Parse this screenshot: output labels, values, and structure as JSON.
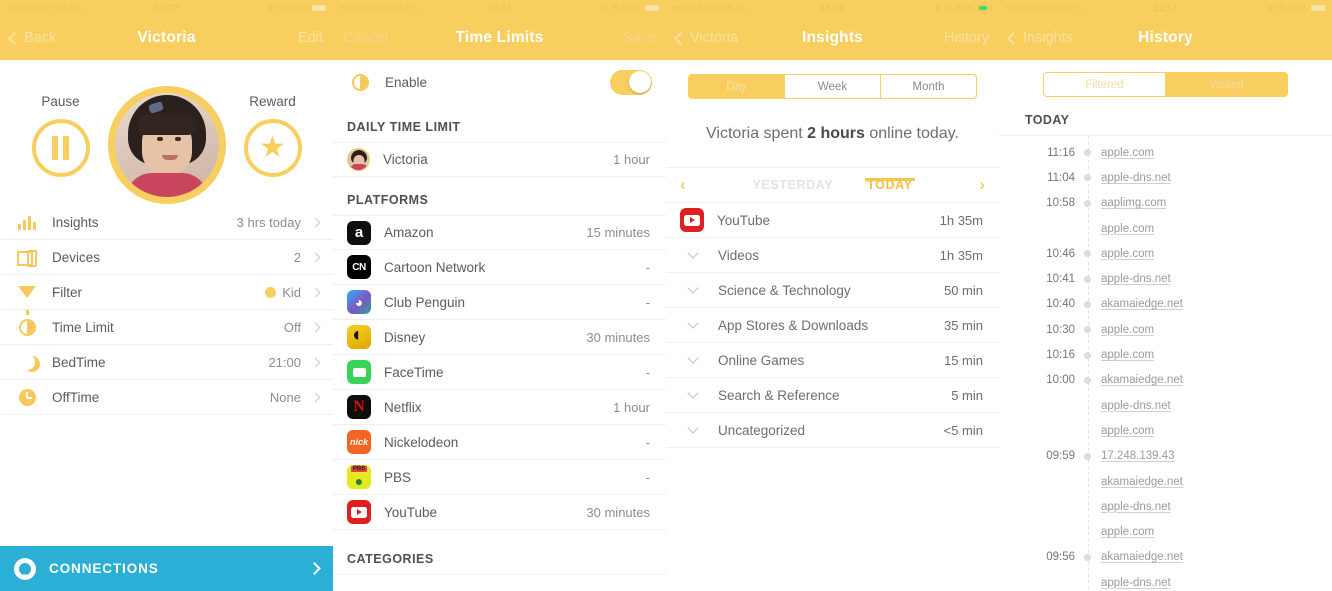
{
  "panels": {
    "profile": {
      "status": {
        "carrier": "Fido Wi-Fi",
        "time": "17:27",
        "battery": "72%"
      },
      "nav": {
        "back": "Back",
        "title": "Victoria",
        "right": "Edit"
      },
      "pause_label": "Pause",
      "reward_label": "Reward",
      "avatar_name": "Victoria",
      "rows": [
        {
          "icon": "insights-bars-icon",
          "label": "Insights",
          "value": "3 hrs today"
        },
        {
          "icon": "devices-icon",
          "label": "Devices",
          "value": "2"
        },
        {
          "icon": "filter-icon",
          "label": "Filter",
          "value": "Kid",
          "dot": true
        },
        {
          "icon": "time-limit-icon",
          "label": "Time Limit",
          "value": "Off"
        },
        {
          "icon": "moon-icon",
          "label": "BedTime",
          "value": "21:00"
        },
        {
          "icon": "clock-icon",
          "label": "OffTime",
          "value": "None"
        }
      ],
      "connections_label": "CONNECTIONS"
    },
    "timelimits": {
      "status": {
        "carrier": "Fido Wi-Fi",
        "time": "14:41",
        "battery": "91%"
      },
      "nav": {
        "left": "Cancel",
        "title": "Time Limits",
        "right": "Save"
      },
      "enable_label": "Enable",
      "enable_on": true,
      "daily_header": "DAILY TIME LIMIT",
      "daily_row": {
        "name": "Victoria",
        "value": "1 hour"
      },
      "platforms_header": "PLATFORMS",
      "platforms": [
        {
          "icon": "amazon-icon",
          "name": "Amazon",
          "value": "15 minutes"
        },
        {
          "icon": "cartoon-network-icon",
          "name": "Cartoon Network",
          "value": "-"
        },
        {
          "icon": "club-penguin-icon",
          "name": "Club Penguin",
          "value": "-"
        },
        {
          "icon": "disney-icon",
          "name": "Disney",
          "value": "30 minutes"
        },
        {
          "icon": "facetime-icon",
          "name": "FaceTime",
          "value": "-"
        },
        {
          "icon": "netflix-icon",
          "name": "Netflix",
          "value": "1 hour"
        },
        {
          "icon": "nickelodeon-icon",
          "name": "Nickelodeon",
          "value": "-"
        },
        {
          "icon": "pbs-icon",
          "name": "PBS",
          "value": "-"
        },
        {
          "icon": "youtube-icon",
          "name": "YouTube",
          "value": "30 minutes"
        }
      ],
      "categories_header": "CATEGORIES"
    },
    "insights": {
      "status": {
        "carrier": "Fido Wi-Fi",
        "time": "15:43",
        "battery": "28%"
      },
      "nav": {
        "back": "Victoria",
        "title": "Insights",
        "right": "History"
      },
      "segments": [
        {
          "label": "Day",
          "active": true
        },
        {
          "label": "Week",
          "active": false
        },
        {
          "label": "Month",
          "active": false
        }
      ],
      "summary_prefix": "Victoria spent ",
      "summary_value": "2 hours",
      "summary_suffix": " online today.",
      "day_prev": "YESTERDAY",
      "day_current": "TODAY",
      "items": [
        {
          "icon": "youtube-icon",
          "label": "YouTube",
          "value": "1h 35m",
          "expandable": false
        },
        {
          "icon": "chevron-down-icon",
          "label": "Videos",
          "value": "1h 35m",
          "expandable": true
        },
        {
          "icon": "chevron-down-icon",
          "label": "Science & Technology",
          "value": "50 min",
          "expandable": true
        },
        {
          "icon": "chevron-down-icon",
          "label": "App Stores & Downloads",
          "value": "35 min",
          "expandable": true
        },
        {
          "icon": "chevron-down-icon",
          "label": "Online Games",
          "value": "15 min",
          "expandable": true
        },
        {
          "icon": "chevron-down-icon",
          "label": "Search & Reference",
          "value": "5 min",
          "expandable": true
        },
        {
          "icon": "chevron-down-icon",
          "label": "Uncategorized",
          "value": "<5 min",
          "expandable": true
        }
      ]
    },
    "history": {
      "status": {
        "carrier": "Fido Wi-Fi",
        "time": "11:17",
        "battery": "88%"
      },
      "nav": {
        "back": "Insights",
        "title": "History"
      },
      "segments": [
        {
          "label": "Filtered",
          "active": false
        },
        {
          "label": "Visited",
          "active": true
        }
      ],
      "group_header": "TODAY",
      "entries": [
        {
          "time": "11:16",
          "site": "apple.com"
        },
        {
          "time": "11:04",
          "site": "apple-dns.net"
        },
        {
          "time": "10:58",
          "site": "aaplimg.com"
        },
        {
          "time": "",
          "site": "apple.com"
        },
        {
          "time": "10:46",
          "site": "apple.com"
        },
        {
          "time": "10:41",
          "site": "apple-dns.net"
        },
        {
          "time": "10:40",
          "site": "akamaiedge.net"
        },
        {
          "time": "10:30",
          "site": "apple.com"
        },
        {
          "time": "10:16",
          "site": "apple.com"
        },
        {
          "time": "10:00",
          "site": "akamaiedge.net"
        },
        {
          "time": "",
          "site": "apple-dns.net"
        },
        {
          "time": "",
          "site": "apple.com"
        },
        {
          "time": "09:59",
          "site": "17.248.139.43"
        },
        {
          "time": "",
          "site": "akamaiedge.net"
        },
        {
          "time": "",
          "site": "apple-dns.net"
        },
        {
          "time": "",
          "site": "apple.com"
        },
        {
          "time": "09:56",
          "site": "akamaiedge.net"
        },
        {
          "time": "",
          "site": "apple-dns.net"
        }
      ]
    }
  },
  "colors": {
    "accent": "#F8CE5E",
    "connections": "#2CAFD6",
    "text": "#5b5b5b"
  }
}
